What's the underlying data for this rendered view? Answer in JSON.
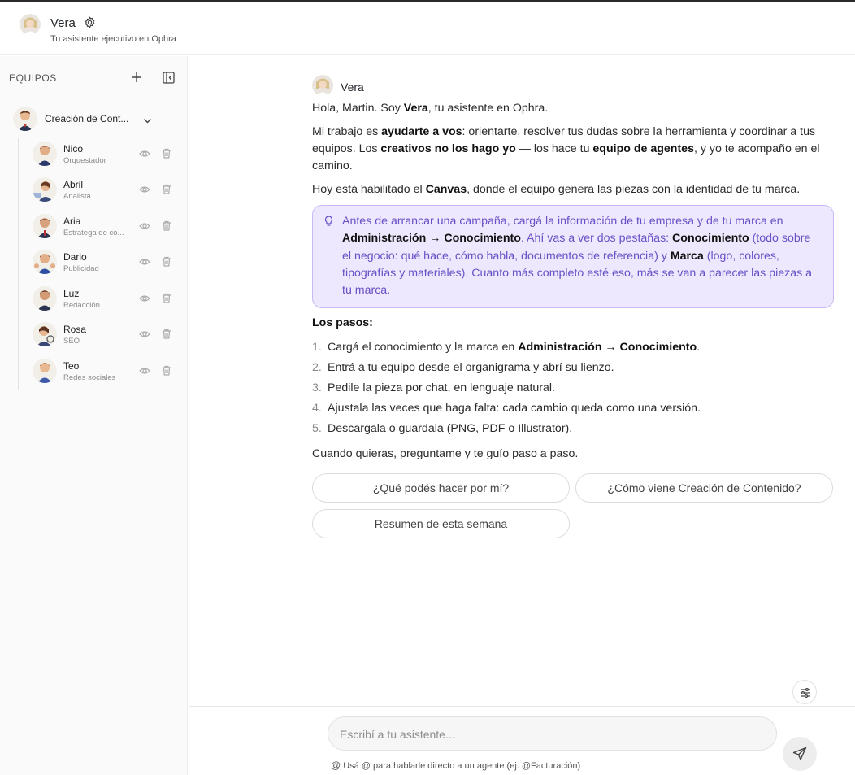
{
  "header": {
    "title": "Vera",
    "subtitle": "Tu asistente ejecutivo en Ophra"
  },
  "sidebar": {
    "title": "EQUIPOS",
    "team": {
      "label": "Creación de Cont..."
    },
    "agents": [
      {
        "name": "Nico",
        "role": "Orquestador"
      },
      {
        "name": "Abril",
        "role": "Analista"
      },
      {
        "name": "Aria",
        "role": "Estratega de co..."
      },
      {
        "name": "Dario",
        "role": "Publicidad"
      },
      {
        "name": "Luz",
        "role": "Redacción"
      },
      {
        "name": "Rosa",
        "role": "SEO"
      },
      {
        "name": "Teo",
        "role": "Redes sociales"
      }
    ]
  },
  "chat": {
    "sender": "Vera",
    "greeting": {
      "a": "Hola, Martin. Soy ",
      "b": "Vera",
      "c": ", tu asistente en Ophra."
    },
    "p2": {
      "a": "Mi trabajo es ",
      "b": "ayudarte a vos",
      "c": ": orientarte, resolver tus dudas sobre la herramienta y coordinar a tus equipos. Los ",
      "d": "creativos no los hago yo",
      "e": " — los hace tu ",
      "f": "equipo de agentes",
      "g": ", y yo te acompaño en el camino."
    },
    "p3": {
      "a": "Hoy está habilitado el ",
      "b": "Canvas",
      "c": ", donde el equipo genera las piezas con la identidad de tu marca."
    },
    "tip": {
      "a": "Antes de arrancar una campaña, cargá la información de tu empresa y de tu marca en ",
      "b": "Administración → Conocimiento",
      "c": ". Ahí vas a ver dos pestañas: ",
      "d": "Conocimiento",
      "e": " (todo sobre el negocio: qué hace, cómo habla, documentos de referencia) y ",
      "f": "Marca",
      "g": " (logo, colores, tipografías y materiales). Cuanto más completo esté eso, más se van a parecer las piezas a tu marca."
    },
    "steps_title": "Los pasos:",
    "steps": [
      {
        "num": "1.",
        "a": "Cargá el conocimiento y la marca en ",
        "b": "Administración → Conocimiento",
        "c": "."
      },
      {
        "num": "2.",
        "a": "Entrá a tu equipo desde el organigrama y abrí su lienzo.",
        "b": "",
        "c": ""
      },
      {
        "num": "3.",
        "a": "Pedile la pieza por chat, en lenguaje natural.",
        "b": "",
        "c": ""
      },
      {
        "num": "4.",
        "a": "Ajustala las veces que haga falta: cada cambio queda como una versión.",
        "b": "",
        "c": ""
      },
      {
        "num": "5.",
        "a": "Descargala o guardala (PNG, PDF o Illustrator).",
        "b": "",
        "c": ""
      }
    ],
    "closing": "Cuando quieras, preguntame y te guío paso a paso.",
    "suggestions": [
      "¿Qué podés hacer por mí?",
      "¿Cómo viene Creación de Contenido?",
      "Resumen de esta semana"
    ]
  },
  "composer": {
    "placeholder": "Escribí a tu asistente...",
    "hint": "Usá @ para hablarle directo a un agente (ej. @Facturación)"
  },
  "colors": {
    "tip_background": "#ede8fd",
    "tip_border": "#c9b8f5",
    "tip_text": "#6a4fc6"
  }
}
